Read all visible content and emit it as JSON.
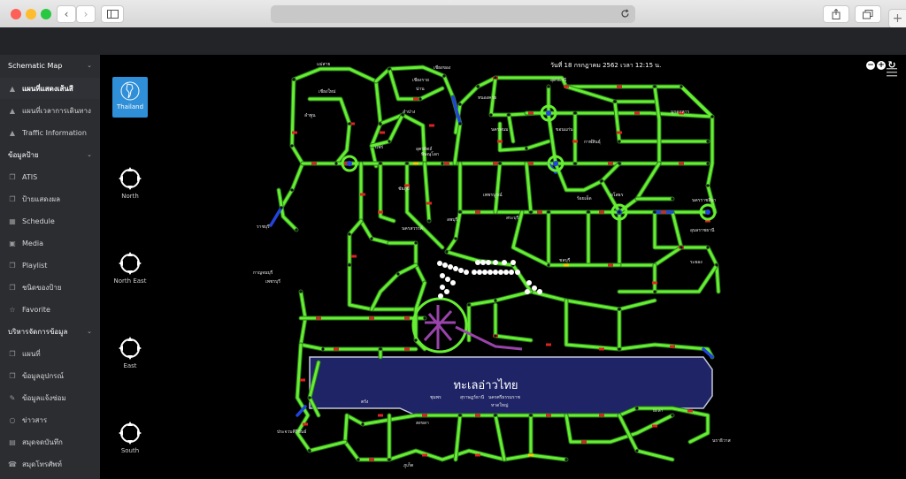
{
  "browser": {
    "back_icon": "chevron-left-icon",
    "forward_icon": "chevron-right-icon",
    "sidebar_icon": "sidebar-toggle-icon",
    "reload_icon": "reload-icon",
    "share_icon": "share-icon",
    "tabs_icon": "tabs-overview-icon",
    "new_tab_label": "+"
  },
  "header": {
    "logo_icon": "globe-logo-icon",
    "menu_icon": "hamburger-icon"
  },
  "sidebar": {
    "items": [
      {
        "label": "Schematic Map",
        "type": "section"
      },
      {
        "label": "แผนที่แสดงเส้นสี",
        "icon": "road-icon",
        "active": true
      },
      {
        "label": "แผนที่เวลาการเดินทาง",
        "icon": "road-icon"
      },
      {
        "label": "Traffic Information",
        "icon": "road-icon"
      },
      {
        "label": "ข้อมูลป้าย",
        "type": "section"
      },
      {
        "label": "ATIS",
        "icon": "copy-icon"
      },
      {
        "label": "ป้ายแสดงผล",
        "icon": "copy-icon"
      },
      {
        "label": "Schedule",
        "icon": "calendar-icon"
      },
      {
        "label": "Media",
        "icon": "image-icon"
      },
      {
        "label": "Playlist",
        "icon": "copy-icon"
      },
      {
        "label": "ชนิดของป้าย",
        "icon": "copy-icon"
      },
      {
        "label": "Favorite",
        "icon": "star-icon"
      },
      {
        "label": "บริหารจัดการข้อมูล",
        "type": "section"
      },
      {
        "label": "แผนที่",
        "icon": "copy-icon"
      },
      {
        "label": "ข้อมูลอุปกรณ์",
        "icon": "copy-icon"
      },
      {
        "label": "ข้อมูลแจ้งซ่อม",
        "icon": "wrench-icon"
      },
      {
        "label": "ข่าวสาร",
        "icon": "chat-icon"
      },
      {
        "label": "สมุดจดบันทึก",
        "icon": "book-icon"
      },
      {
        "label": "สมุดโทรศัพท์",
        "icon": "phone-icon"
      }
    ]
  },
  "regions": [
    {
      "label": "Thailand",
      "active": true
    },
    {
      "label": "North"
    },
    {
      "label": "North East"
    },
    {
      "label": "East"
    },
    {
      "label": "South"
    }
  ],
  "map": {
    "datetime": "วันที่ 18 กรกฎาคม 2562 เวลา 12:15 น.",
    "sea_label": "ทะเลอ่าวไทย",
    "controls": [
      "zoom-out-icon",
      "zoom-in-icon",
      "refresh-icon"
    ],
    "colors": {
      "road": "#66ee33",
      "road_outline": "#2a7a1a",
      "slow": "#dd2222",
      "medium": "#ffcc00",
      "closed": "#2244dd",
      "sea": "#1e2466",
      "ring": "#9944aa"
    },
    "labels": [
      "แม่สาย",
      "เชียงของ",
      "เชียงราย",
      "เชียงใหม่",
      "ลำพูน",
      "น่าน",
      "ลำปาง",
      "แพร่",
      "อุตรดิตถ์",
      "พิษณุโลก",
      "หนองคาย",
      "อุดรธานี",
      "นครพนม",
      "มุกดาหาร",
      "ขอนแก่น",
      "กาฬสินธุ์",
      "ร้อยเอ็ด",
      "ยโสธร",
      "อุบลราชธานี",
      "นครราชสีมา",
      "ชัยภูมิ",
      "เพชรบูรณ์",
      "ลพบุรี",
      "สระบุรี",
      "นครสวรรค์",
      "กาญจนบุรี",
      "ราชบุรี",
      "เพชรบุรี",
      "ชลบุรี",
      "ระยอง",
      "ประจวบคีรีขันธ์",
      "ชุมพร",
      "สุราษฎร์ธานี",
      "นครศรีธรรมราช",
      "ภูเก็ต",
      "ตรัง",
      "สงขลา",
      "หาดใหญ่",
      "ยะลา",
      "นราธิวาส"
    ]
  }
}
